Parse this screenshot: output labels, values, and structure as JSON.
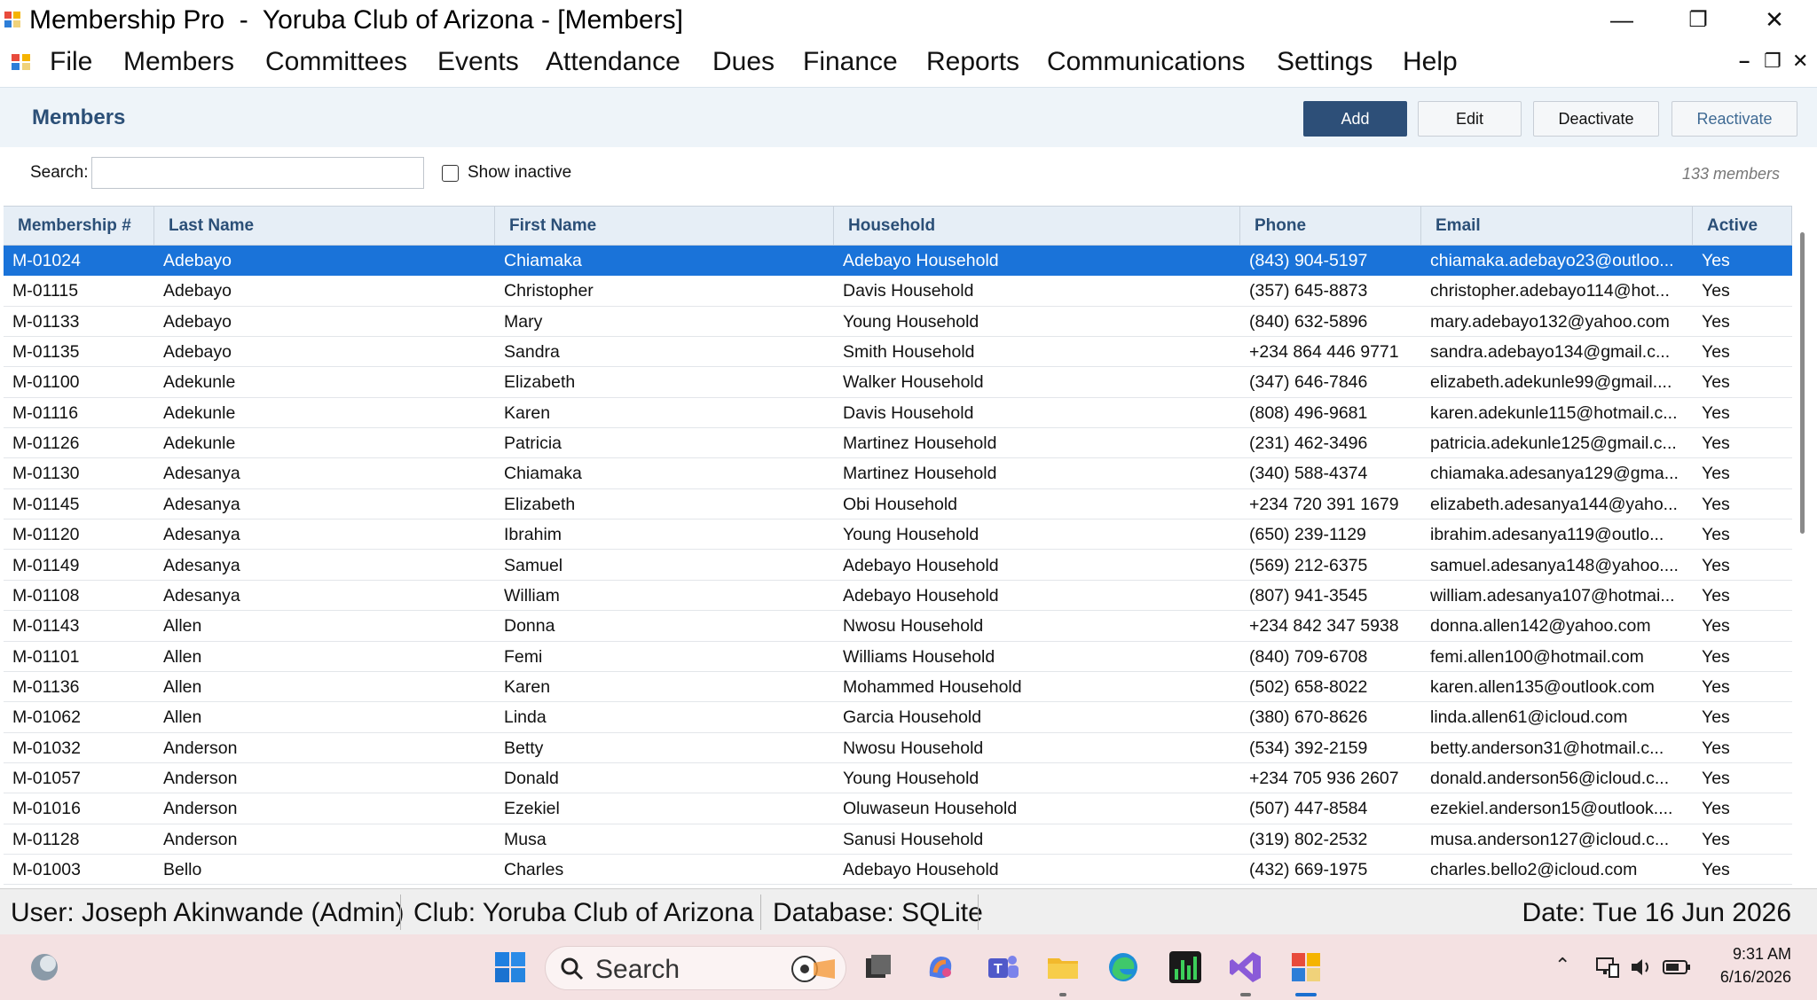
{
  "window": {
    "title": "Membership Pro  -  Yoruba Club of Arizona - [Members]",
    "minimize": "—",
    "restore": "❐",
    "close": "✕"
  },
  "menu": {
    "items": [
      "File",
      "Members",
      "Committees",
      "Events",
      "Attendance",
      "Dues",
      "Finance",
      "Reports",
      "Communications",
      "Settings",
      "Help"
    ],
    "mdi_minimize": "–",
    "mdi_restore": "❐",
    "mdi_close": "✕"
  },
  "header": {
    "title": "Members",
    "add_label": "Add",
    "edit_label": "Edit",
    "deactivate_label": "Deactivate",
    "reactivate_label": "Reactivate"
  },
  "filter": {
    "search_label": "Search:",
    "search_value": "",
    "show_inactive_label": "Show inactive",
    "show_inactive_checked": false,
    "count_text": "133 members"
  },
  "grid": {
    "columns": [
      "Membership #",
      "Last Name",
      "First Name",
      "Household",
      "Phone",
      "Email",
      "Active"
    ],
    "selected_index": 0,
    "rows": [
      [
        "M-01024",
        "Adebayo",
        "Chiamaka",
        "Adebayo Household",
        "(843) 904-5197",
        "chiamaka.adebayo23@outloo...",
        "Yes"
      ],
      [
        "M-01115",
        "Adebayo",
        "Christopher",
        "Davis Household",
        "(357) 645-8873",
        "christopher.adebayo114@hot...",
        "Yes"
      ],
      [
        "M-01133",
        "Adebayo",
        "Mary",
        "Young Household",
        "(840) 632-5896",
        "mary.adebayo132@yahoo.com",
        "Yes"
      ],
      [
        "M-01135",
        "Adebayo",
        "Sandra",
        "Smith Household",
        "+234 864 446 9771",
        "sandra.adebayo134@gmail.c...",
        "Yes"
      ],
      [
        "M-01100",
        "Adekunle",
        "Elizabeth",
        "Walker Household",
        "(347) 646-7846",
        "elizabeth.adekunle99@gmail....",
        "Yes"
      ],
      [
        "M-01116",
        "Adekunle",
        "Karen",
        "Davis Household",
        "(808) 496-9681",
        "karen.adekunle115@hotmail.c...",
        "Yes"
      ],
      [
        "M-01126",
        "Adekunle",
        "Patricia",
        "Martinez Household",
        "(231) 462-3496",
        "patricia.adekunle125@gmail.c...",
        "Yes"
      ],
      [
        "M-01130",
        "Adesanya",
        "Chiamaka",
        "Martinez Household",
        "(340) 588-4374",
        "chiamaka.adesanya129@gma...",
        "Yes"
      ],
      [
        "M-01145",
        "Adesanya",
        "Elizabeth",
        "Obi Household",
        "+234 720 391 1679",
        "elizabeth.adesanya144@yaho...",
        "Yes"
      ],
      [
        "M-01120",
        "Adesanya",
        "Ibrahim",
        "Young Household",
        "(650) 239-1129",
        "ibrahim.adesanya119@outlo...",
        "Yes"
      ],
      [
        "M-01149",
        "Adesanya",
        "Samuel",
        "Adebayo Household",
        "(569) 212-6375",
        "samuel.adesanya148@yahoo....",
        "Yes"
      ],
      [
        "M-01108",
        "Adesanya",
        "William",
        "Adebayo Household",
        "(807) 941-3545",
        "william.adesanya107@hotmai...",
        "Yes"
      ],
      [
        "M-01143",
        "Allen",
        "Donna",
        "Nwosu Household",
        "+234 842 347 5938",
        "donna.allen142@yahoo.com",
        "Yes"
      ],
      [
        "M-01101",
        "Allen",
        "Femi",
        "Williams Household",
        "(840) 709-6708",
        "femi.allen100@hotmail.com",
        "Yes"
      ],
      [
        "M-01136",
        "Allen",
        "Karen",
        "Mohammed Household",
        "(502) 658-8022",
        "karen.allen135@outlook.com",
        "Yes"
      ],
      [
        "M-01062",
        "Allen",
        "Linda",
        "Garcia Household",
        "(380) 670-8626",
        "linda.allen61@icloud.com",
        "Yes"
      ],
      [
        "M-01032",
        "Anderson",
        "Betty",
        "Nwosu Household",
        "(534) 392-2159",
        "betty.anderson31@hotmail.c...",
        "Yes"
      ],
      [
        "M-01057",
        "Anderson",
        "Donald",
        "Young Household",
        "+234 705 936 2607",
        "donald.anderson56@icloud.c...",
        "Yes"
      ],
      [
        "M-01016",
        "Anderson",
        "Ezekiel",
        "Oluwaseun Household",
        "(507) 447-8584",
        "ezekiel.anderson15@outlook....",
        "Yes"
      ],
      [
        "M-01128",
        "Anderson",
        "Musa",
        "Sanusi Household",
        "(319) 802-2532",
        "musa.anderson127@icloud.c...",
        "Yes"
      ],
      [
        "M-01003",
        "Bello",
        "Charles",
        "Adebayo Household",
        "(432) 669-1975",
        "charles.bello2@icloud.com",
        "Yes"
      ]
    ]
  },
  "status": {
    "user": "User: Joseph Akinwande (Admin)",
    "club": "Club: Yoruba Club of Arizona",
    "database": "Database: SQLite",
    "date": "Date: Tue  16 Jun 2026"
  },
  "taskbar": {
    "search_label": "Search",
    "time": "9:31 AM",
    "date": "6/16/2026"
  },
  "colors": {
    "accent": "#2d4f78",
    "selection": "#1a73d9",
    "header_text": "#2b4f77",
    "taskbar": "#f4e1e2"
  }
}
